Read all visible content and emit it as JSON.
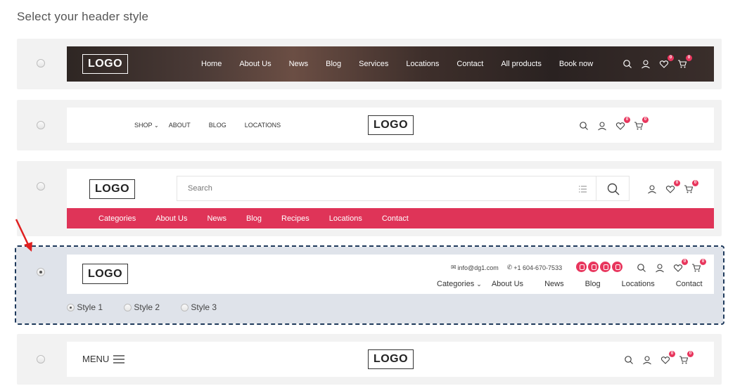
{
  "page_title": "Select your header style",
  "logo_text": "LOGO",
  "accent_color": "#df3458",
  "badge_count": "0",
  "option1": {
    "nav": [
      "Home",
      "About Us",
      "News",
      "Blog",
      "Services",
      "Locations",
      "Contact",
      "All products",
      "Book now"
    ]
  },
  "option2": {
    "nav": [
      "SHOP",
      "ABOUT",
      "BLOG",
      "LOCATIONS"
    ]
  },
  "option3": {
    "search_placeholder": "Search",
    "nav": [
      "Categories",
      "About Us",
      "News",
      "Blog",
      "Recipes",
      "Locations",
      "Contact"
    ]
  },
  "option4": {
    "email": "info@dg1.com",
    "phone": "+1 604-670-7533",
    "nav": [
      "Categories",
      "About Us",
      "News",
      "Blog",
      "Locations",
      "Contact"
    ],
    "styles": [
      "Style 1",
      "Style 2",
      "Style 3"
    ],
    "selected_style": "Style 1"
  },
  "option5": {
    "menu_label": "MENU"
  },
  "icons": [
    "search-icon",
    "user-icon",
    "heart-icon",
    "cart-icon",
    "list-icon",
    "menu-icon",
    "mail-icon",
    "phone-icon",
    "chevron-down-icon"
  ]
}
